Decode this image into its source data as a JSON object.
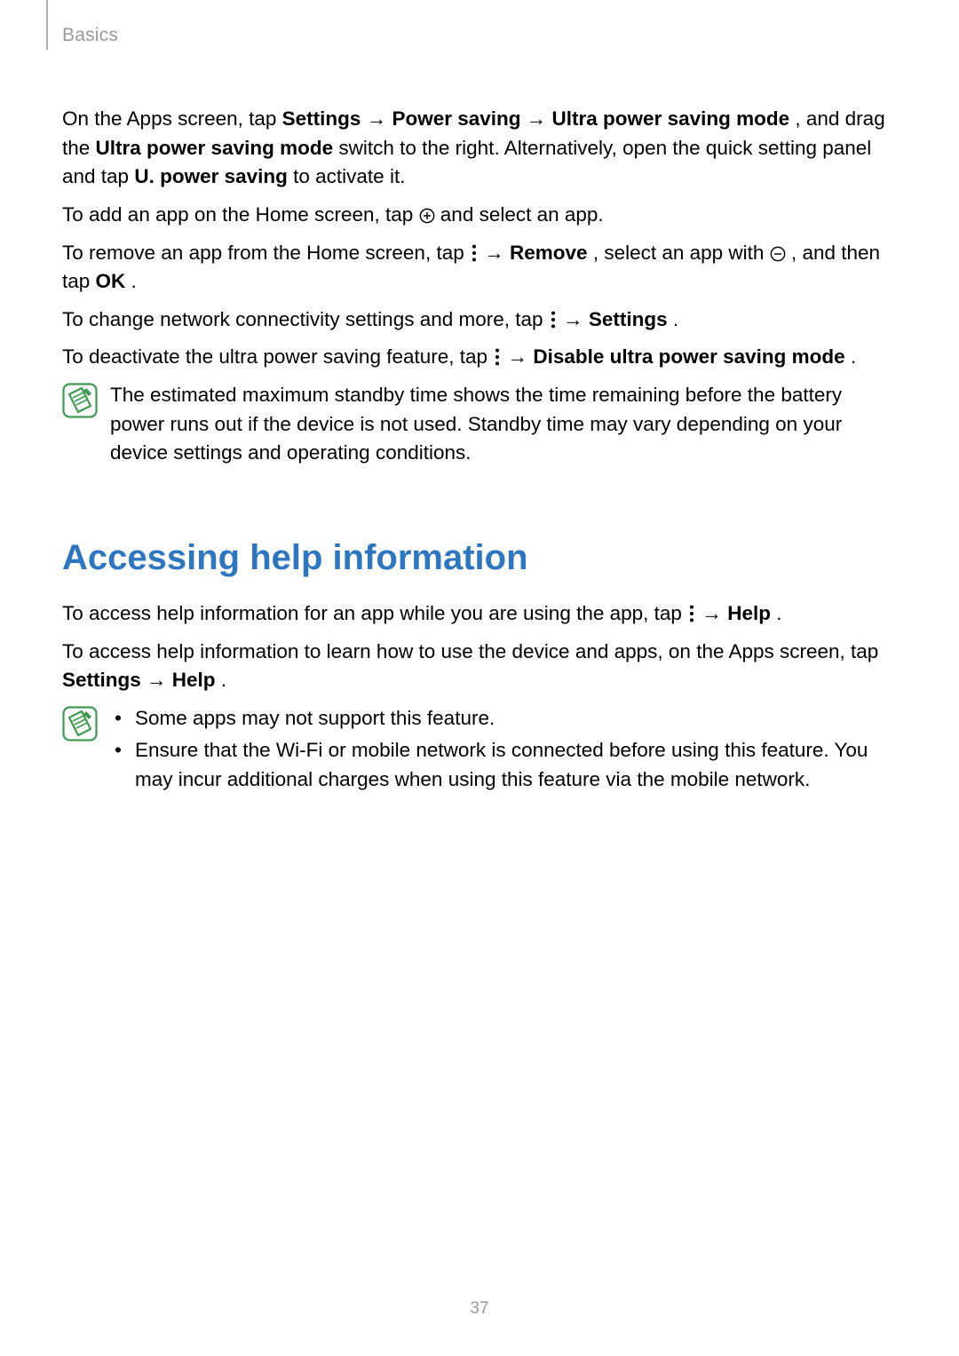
{
  "header": {
    "section": "Basics"
  },
  "arrow": "→",
  "icons": {
    "plus": "plus-circle-icon",
    "minus": "minus-circle-icon",
    "kebab": "kebab-icon",
    "note": "note-icon"
  },
  "power": {
    "p1_a": "On the Apps screen, tap ",
    "p1_b1": "Settings",
    "p1_b2": "Power saving",
    "p1_b3": "Ultra power saving mode",
    "p1_c": ", and drag the ",
    "p1_d": "Ultra power saving mode",
    "p1_e": " switch to the right. Alternatively, open the quick setting panel and tap ",
    "p1_f": "U. power saving",
    "p1_g": " to activate it.",
    "p2_a": "To add an app on the Home screen, tap ",
    "p2_b": " and select an app.",
    "p3_a": "To remove an app from the Home screen, tap ",
    "p3_b": "Remove",
    "p3_c": ", select an app with ",
    "p3_d": ", and then tap ",
    "p3_e": "OK",
    "p3_f": ".",
    "p4_a": "To change network connectivity settings and more, tap ",
    "p4_b": "Settings",
    "p4_c": ".",
    "p5_a": "To deactivate the ultra power saving feature, tap ",
    "p5_b": "Disable ultra power saving mode",
    "p5_c": ".",
    "note": "The estimated maximum standby time shows the time remaining before the battery power runs out if the device is not used. Standby time may vary depending on your device settings and operating conditions."
  },
  "help": {
    "heading": "Accessing help information",
    "p1_a": "To access help information for an app while you are using the app, tap ",
    "p1_b": "Help",
    "p1_c": ".",
    "p2_a": "To access help information to learn how to use the device and apps, on the Apps screen, tap ",
    "p2_b1": "Settings",
    "p2_b2": "Help",
    "p2_c": ".",
    "bullets": [
      "Some apps may not support this feature.",
      "Ensure that the Wi-Fi or mobile network is connected before using this feature. You may incur additional charges when using this feature via the mobile network."
    ]
  },
  "page_number": "37"
}
